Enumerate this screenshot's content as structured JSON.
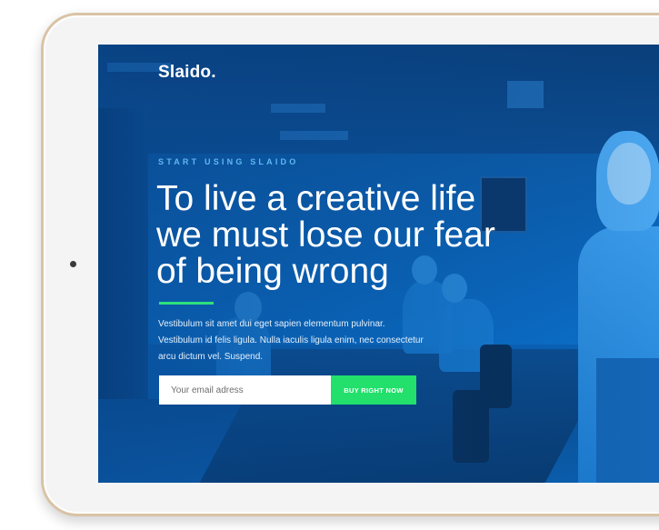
{
  "site": {
    "logo": "Slaido."
  },
  "hero": {
    "eyebrow": "START USING SLAIDO",
    "headline_line1": "To live a creative life",
    "headline_line2": "we must lose our fear",
    "headline_line3": "of being wrong",
    "body": "Vestibulum sit amet dui eget sapien elementum pulvinar. Vestibulum id felis ligula. Nulla iaculis ligula enim, nec consectetur arcu dictum vel. Suspend.",
    "accent_color": "#2ee07a",
    "overlay_color": "#0a66bd"
  },
  "signup": {
    "email_placeholder": "Your email adress",
    "email_value": "",
    "button_label": "BUY RIGHT NOW",
    "button_color": "#22e06b"
  },
  "device": {
    "type": "tablet",
    "frame_color": "#f4f4f4",
    "trim_color": "#d9c3a5"
  }
}
